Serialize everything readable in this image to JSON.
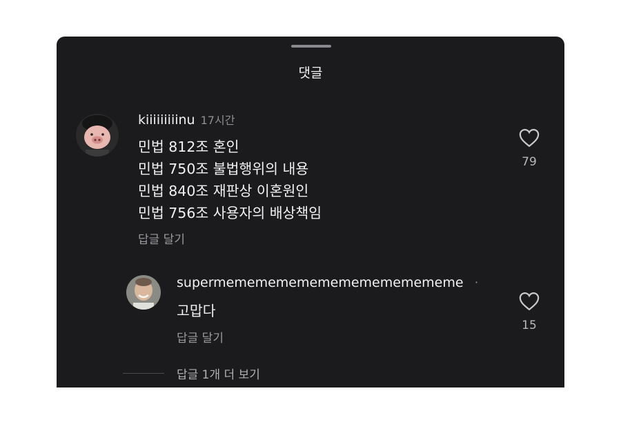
{
  "sheet": {
    "title": "댓글"
  },
  "comment": {
    "username": "kiiiiiiiiinu",
    "time": "17시간",
    "lines": [
      "민법 812조 혼인",
      "민법 750조 불법행위의 내용",
      "민법 840조 재판상 이혼원인",
      "민법 756조 사용자의 배상책임"
    ],
    "reply_label": "답글 달기",
    "likes": "79"
  },
  "reply": {
    "username": "supermemememememememememememe",
    "dot": "·",
    "text": "고맙다",
    "reply_label": "답글 달기",
    "likes": "15"
  },
  "more_replies": "답글 1개 더 보기",
  "colors": {
    "background": "#1b1b1d",
    "text_primary": "#f1f1f1",
    "text_secondary": "#9a9a9e"
  },
  "icons": [
    "heart-icon",
    "drag-handle"
  ]
}
